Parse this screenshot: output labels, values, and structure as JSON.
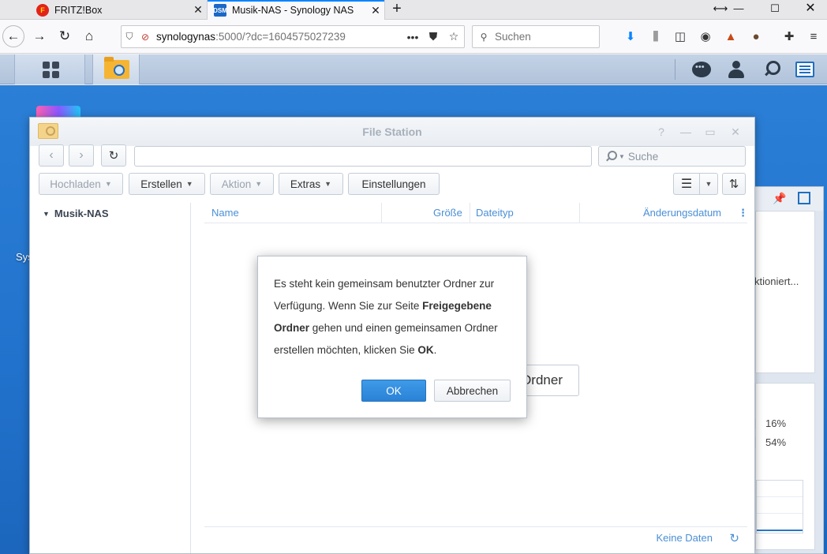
{
  "browser": {
    "tabs": [
      {
        "title": "FRITZ!Box",
        "favicon": "fritzbox-icon"
      },
      {
        "title": "Musik-NAS - Synology NAS",
        "favicon": "dsm-icon"
      }
    ],
    "url_host": "synologynas",
    "url_rest": ":5000/?dc=1604575027239",
    "search_placeholder": "Suchen",
    "favicon_texts": {
      "fritz": "F",
      "dsm": "DSM"
    },
    "accent_color": "#0a84ff"
  },
  "file_station": {
    "title": "File Station",
    "search_placeholder": "Suche",
    "toolbar": {
      "upload": "Hochladen",
      "create": "Erstellen",
      "action": "Aktion",
      "extras": "Extras",
      "settings": "Einstellungen"
    },
    "tree": {
      "root": "Musik-NAS"
    },
    "columns": {
      "name": "Name",
      "size": "Größe",
      "type": "Dateityp",
      "modified": "Änderungsdatum"
    },
    "background_button": "Ordner",
    "status": "Keine Daten"
  },
  "dialog": {
    "text_1": "Es steht kein gemeinsam benutzter Ordner zur Verfügung. Wenn Sie zur Seite ",
    "bold_1": "Freigegebene Ordner",
    "text_2": " gehen und einen gemeinsamen Ordner erstellen möchten, klicken Sie ",
    "bold_2": "OK",
    "text_3": ".",
    "ok_label": "OK",
    "cancel_label": "Abbrechen"
  },
  "desktop": {
    "label": "Sys",
    "widget_text": "ktioniert...",
    "cpu_pct": "16%",
    "ram_pct": "54%"
  },
  "colors": {
    "primary_button": "#2a82d6",
    "desktop_bg": "#2172cc",
    "link_blue": "#4a8fd6"
  }
}
